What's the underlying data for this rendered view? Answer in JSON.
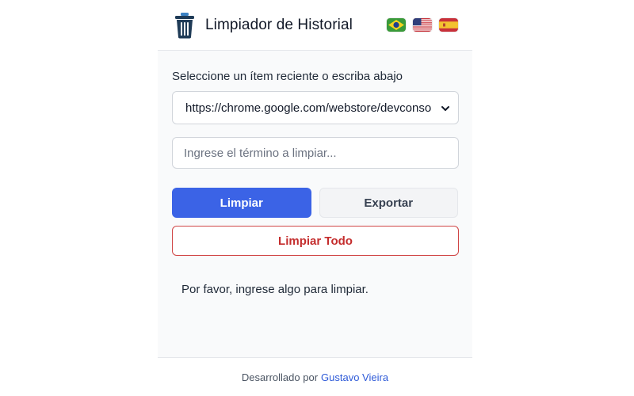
{
  "header": {
    "title": "Limpiador de Historial",
    "logo_icon": "trash-can-icon",
    "languages": [
      {
        "code": "pt-BR",
        "icon": "brazil-flag-icon"
      },
      {
        "code": "en-US",
        "icon": "us-flag-icon"
      },
      {
        "code": "es",
        "icon": "spain-flag-icon"
      }
    ]
  },
  "main": {
    "recent_label": "Seleccione un ítem reciente o escriba abajo",
    "recent_select_value": "https://chrome.google.com/webstore/devconso",
    "term_input_value": "",
    "term_input_placeholder": "Ingrese el término a limpiar...",
    "clean_button": "Limpiar",
    "export_button": "Exportar",
    "clean_all_button": "Limpiar Todo",
    "status_message": "Por favor, ingrese algo para limpiar."
  },
  "footer": {
    "prefix": "Desarrollado por",
    "author": "Gustavo Vieira"
  },
  "colors": {
    "primary": "#3b63e6",
    "danger": "#c42d2d",
    "link": "#2f5bd8"
  }
}
